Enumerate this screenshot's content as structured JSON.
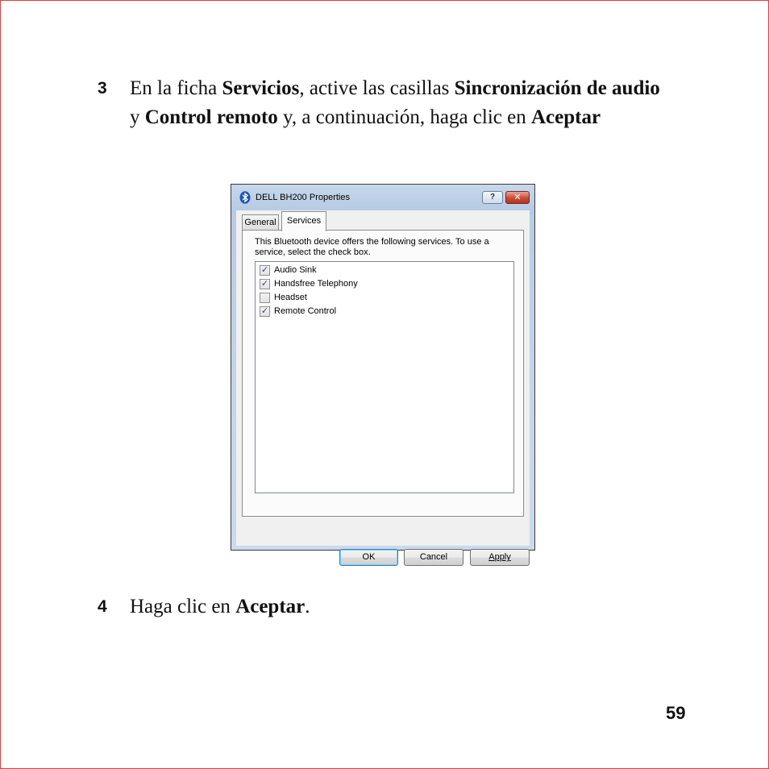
{
  "step3": {
    "number": "3",
    "t1": "En la ficha ",
    "b1": "Servicios",
    "t2": ", active las casillas ",
    "b2": "Sincronización de audio",
    "t3": " y ",
    "b3": "Control remoto",
    "t4": " y, a continuación, haga clic en ",
    "b4": "Aceptar"
  },
  "dialog": {
    "title": "DELL BH200 Properties",
    "help_label": "?",
    "close_label": "✕",
    "tabs": [
      {
        "label": "General",
        "selected": false
      },
      {
        "label": "Services",
        "selected": true
      }
    ],
    "description": "This Bluetooth device offers the following services. To use a service, select the check box.",
    "services": [
      {
        "label": "Audio Sink",
        "checked": true
      },
      {
        "label": "Handsfree Telephony",
        "checked": true
      },
      {
        "label": "Headset",
        "checked": false
      },
      {
        "label": "Remote Control",
        "checked": true
      }
    ],
    "buttons": {
      "ok": "OK",
      "cancel": "Cancel",
      "apply": "Apply"
    }
  },
  "step4": {
    "number": "4",
    "t1": "Haga clic en ",
    "b1": "Aceptar",
    "t2": "."
  },
  "page_number": "59"
}
